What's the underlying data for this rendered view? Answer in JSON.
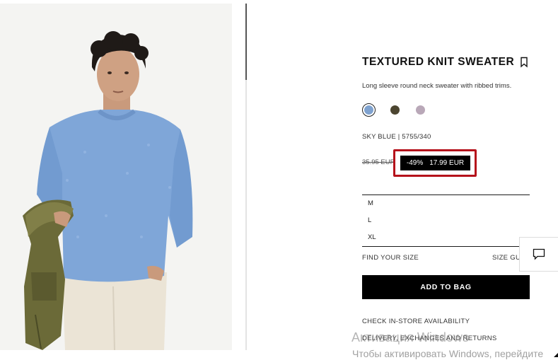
{
  "product": {
    "image_alt": "model-wearing-sweater",
    "title": "TEXTURED KNIT SWEATER",
    "description": "Long sleeve round neck sweater with ribbed trims.",
    "color_line": "SKY BLUE | 5755/340",
    "old_price": "35.95 EUR",
    "discount": "-49%",
    "sale_price": "17.99 EUR",
    "swatches": [
      {
        "name": "sky-blue",
        "color": "#7fa2cf",
        "selected": true
      },
      {
        "name": "dark-olive",
        "color": "#4c4530",
        "selected": false
      },
      {
        "name": "mauve",
        "color": "#b9a8b8",
        "selected": false
      }
    ],
    "sizes": [
      "M",
      "L",
      "XL"
    ]
  },
  "actions": {
    "find_size": "FIND YOUR SIZE",
    "size_guide": "SIZE GUIDE",
    "add_to_bag": "ADD TO BAG",
    "check_store": "CHECK IN-STORE AVAILABILITY",
    "delivery": "DELIVERY, EXCHANGES AND RETURNS"
  },
  "icons": {
    "bookmark": "bookmark-icon",
    "chat": "chat-icon"
  },
  "colors": {
    "highlight_border": "#b5121b",
    "button_bg": "#000000",
    "sweater": "#7fa6d8"
  },
  "watermark": {
    "line1": "Активация Windows",
    "line2": "Чтобы активировать Windows, перейдите"
  }
}
